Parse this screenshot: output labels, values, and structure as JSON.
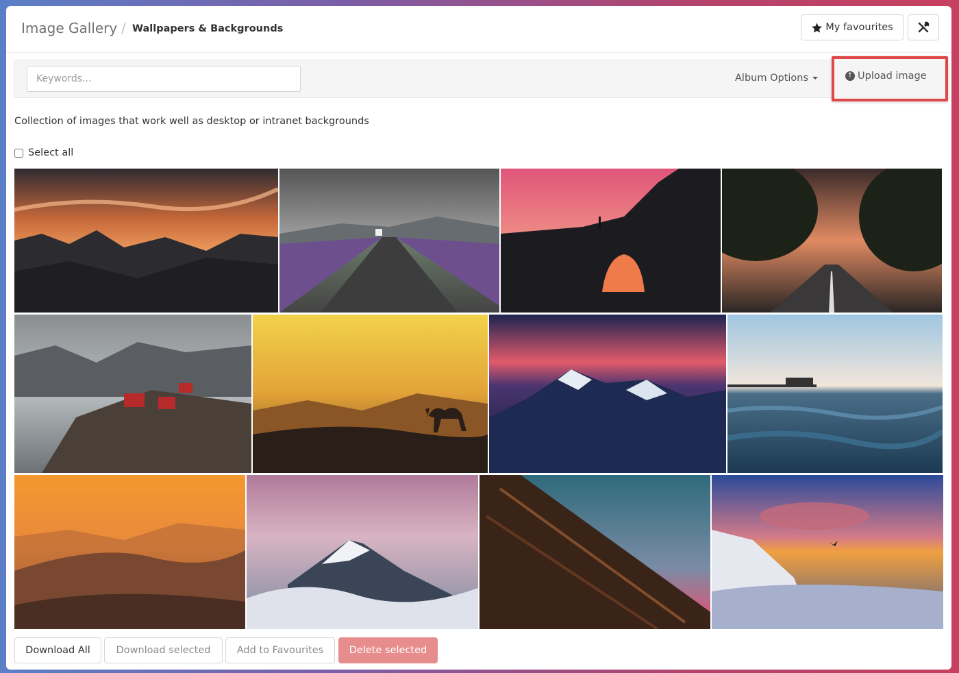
{
  "header": {
    "breadcrumb_root": "Image Gallery",
    "breadcrumb_separator": "/",
    "breadcrumb_current": "Wallpapers & Backgrounds",
    "favourites_label": "My favourites",
    "favourites_icon": "star-icon",
    "tools_icon": "tools-icon"
  },
  "toolbar": {
    "search_placeholder": "Keywords...",
    "album_options_label": "Album Options",
    "upload_label": "Upload image",
    "upload_icon": "upload-icon",
    "highlight_color": "#e04848"
  },
  "gallery": {
    "description": "Collection of images that work well as desktop or intranet backgrounds",
    "select_all_label": "Select all",
    "images": [
      {
        "name": "mountain-sunset"
      },
      {
        "name": "lavender-road"
      },
      {
        "name": "rock-arch"
      },
      {
        "name": "tree-road"
      },
      {
        "name": "fishing-village"
      },
      {
        "name": "desert-camel"
      },
      {
        "name": "snowy-peak-dusk"
      },
      {
        "name": "pier-sea"
      },
      {
        "name": "orange-hills"
      },
      {
        "name": "snow-mountain-clouds"
      },
      {
        "name": "dark-slope"
      },
      {
        "name": "alpine-sunset-bird"
      }
    ]
  },
  "footer": {
    "download_all": "Download All",
    "download_selected": "Download selected",
    "add_to_favourites": "Add to Favourites",
    "delete_selected": "Delete selected",
    "delete_color": "#e88d8d"
  }
}
